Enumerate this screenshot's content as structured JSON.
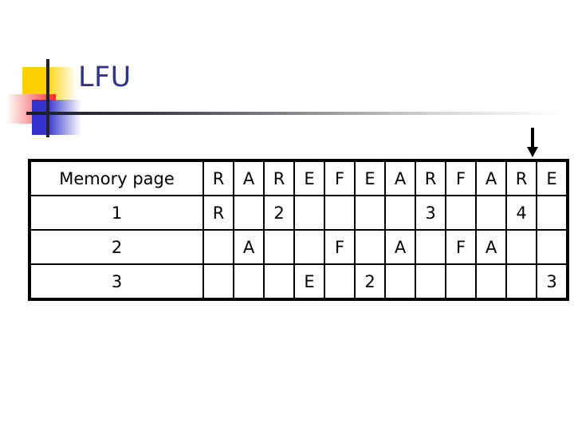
{
  "slide": {
    "title": "LFU"
  },
  "pointer": {
    "icon": "down-arrow-icon",
    "target_column_index": 11
  },
  "table": {
    "row_header_label": "Memory page",
    "reference_string": [
      "R",
      "A",
      "R",
      "E",
      "F",
      "E",
      "A",
      "R",
      "F",
      "A",
      "R",
      "E"
    ],
    "rows": [
      {
        "label": "1",
        "cells": [
          {
            "text": "R",
            "color": "purple"
          },
          {
            "text": "",
            "color": ""
          },
          {
            "text": "2",
            "color": "red"
          },
          {
            "text": "",
            "color": ""
          },
          {
            "text": "",
            "color": ""
          },
          {
            "text": "",
            "color": ""
          },
          {
            "text": "",
            "color": ""
          },
          {
            "text": "3",
            "color": "red"
          },
          {
            "text": "",
            "color": ""
          },
          {
            "text": "",
            "color": ""
          },
          {
            "text": "4",
            "color": "red"
          },
          {
            "text": "",
            "color": ""
          }
        ]
      },
      {
        "label": "2",
        "cells": [
          {
            "text": "",
            "color": ""
          },
          {
            "text": "A",
            "color": "purple"
          },
          {
            "text": "",
            "color": ""
          },
          {
            "text": "",
            "color": ""
          },
          {
            "text": "F",
            "color": "purple"
          },
          {
            "text": "",
            "color": ""
          },
          {
            "text": "A",
            "color": "purple"
          },
          {
            "text": "",
            "color": ""
          },
          {
            "text": "F",
            "color": "purple"
          },
          {
            "text": "A",
            "color": "purple"
          },
          {
            "text": "",
            "color": ""
          },
          {
            "text": "",
            "color": ""
          }
        ]
      },
      {
        "label": "3",
        "cells": [
          {
            "text": "",
            "color": ""
          },
          {
            "text": "",
            "color": ""
          },
          {
            "text": "",
            "color": ""
          },
          {
            "text": "E",
            "color": "purple"
          },
          {
            "text": "",
            "color": ""
          },
          {
            "text": "2",
            "color": "red"
          },
          {
            "text": "",
            "color": ""
          },
          {
            "text": "",
            "color": ""
          },
          {
            "text": "",
            "color": ""
          },
          {
            "text": "",
            "color": ""
          },
          {
            "text": "",
            "color": ""
          },
          {
            "text": "3",
            "color": "red"
          }
        ]
      }
    ]
  },
  "colors": {
    "title": "#333388",
    "purple": "#CC66DD",
    "red": "#BB1122",
    "deco_yellow": "#FFD000",
    "deco_red": "#FF2424",
    "deco_blue": "#3333CC",
    "grid": "#000000"
  }
}
